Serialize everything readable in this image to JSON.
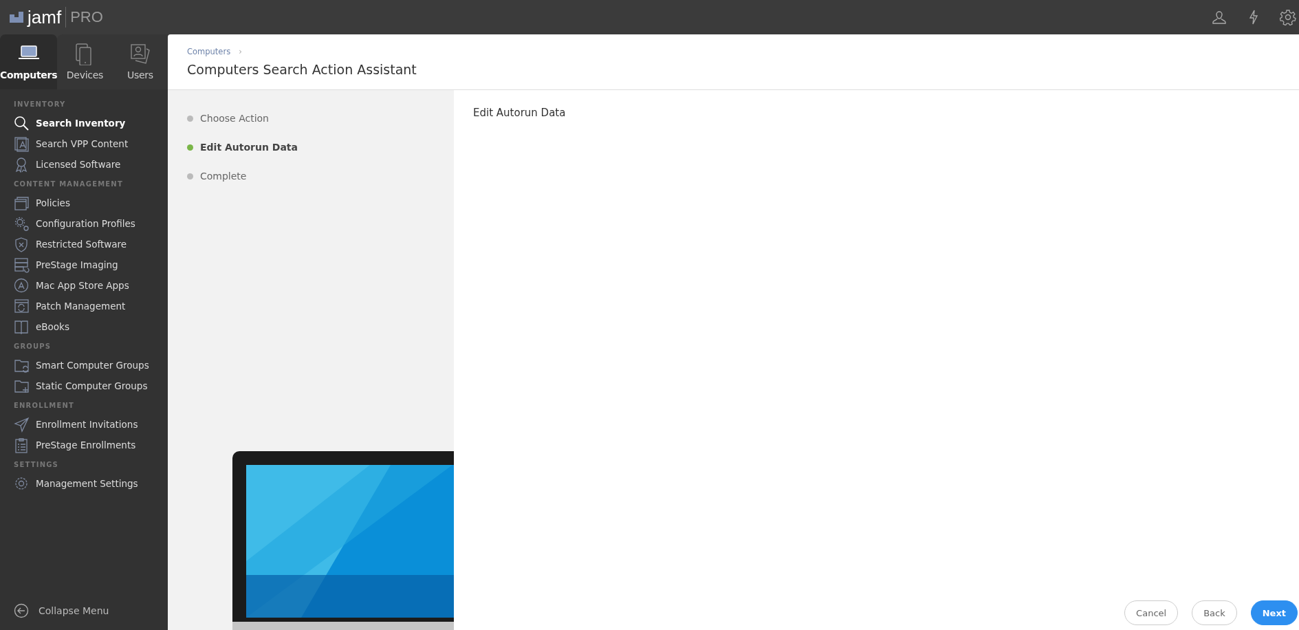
{
  "brand": {
    "logo": "jamf",
    "product": "PRO"
  },
  "nav_tabs": [
    {
      "label": "Computers",
      "selected": true
    },
    {
      "label": "Devices",
      "selected": false
    },
    {
      "label": "Users",
      "selected": false
    }
  ],
  "sidebar": {
    "sections": [
      {
        "title": "INVENTORY",
        "items": [
          {
            "label": "Search Inventory",
            "selected": true
          },
          {
            "label": "Search VPP Content",
            "selected": false
          },
          {
            "label": "Licensed Software",
            "selected": false
          }
        ]
      },
      {
        "title": "CONTENT MANAGEMENT",
        "items": [
          {
            "label": "Policies",
            "selected": false
          },
          {
            "label": "Configuration Profiles",
            "selected": false
          },
          {
            "label": "Restricted Software",
            "selected": false
          },
          {
            "label": "PreStage Imaging",
            "selected": false
          },
          {
            "label": "Mac App Store Apps",
            "selected": false
          },
          {
            "label": "Patch Management",
            "selected": false
          },
          {
            "label": "eBooks",
            "selected": false
          }
        ]
      },
      {
        "title": "GROUPS",
        "items": [
          {
            "label": "Smart Computer Groups",
            "selected": false
          },
          {
            "label": "Static Computer Groups",
            "selected": false
          }
        ]
      },
      {
        "title": "ENROLLMENT",
        "items": [
          {
            "label": "Enrollment Invitations",
            "selected": false
          },
          {
            "label": "PreStage Enrollments",
            "selected": false
          }
        ]
      },
      {
        "title": "SETTINGS",
        "items": [
          {
            "label": "Management Settings",
            "selected": false
          }
        ]
      }
    ],
    "collapse": "Collapse Menu"
  },
  "header": {
    "breadcrumb": "Computers",
    "separator": "›",
    "title": "Computers Search Action Assistant"
  },
  "steps": [
    {
      "label": "Choose Action",
      "selected": false
    },
    {
      "label": "Edit Autorun Data",
      "selected": true
    },
    {
      "label": "Complete",
      "selected": false
    }
  ],
  "panel": {
    "title": "Edit Autorun Data"
  },
  "buttons": [
    {
      "label": "Cancel",
      "kind": "secondary"
    },
    {
      "label": "Back",
      "kind": "secondary"
    },
    {
      "label": "Next",
      "kind": "primary"
    }
  ]
}
